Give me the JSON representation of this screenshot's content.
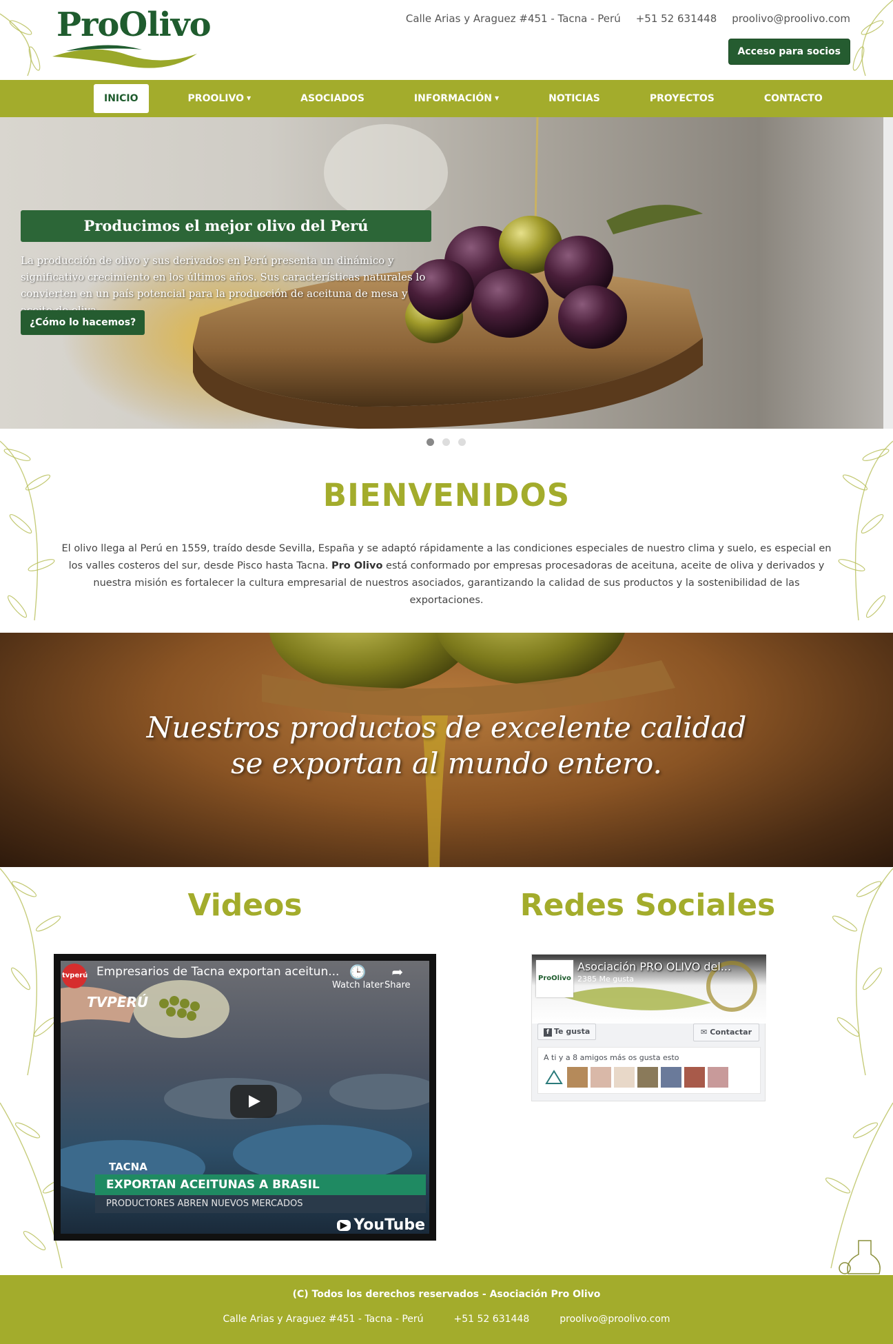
{
  "header": {
    "logo_text": "ProOlivo",
    "address": "Calle Arias y Araguez #451 - Tacna - Perú",
    "phone": "+51 52 631448",
    "email": "proolivo@proolivo.com",
    "members_button": "Acceso para socios"
  },
  "nav": {
    "items": [
      {
        "label": "INICIO",
        "active": true
      },
      {
        "label": "PROOLIVO",
        "dropdown": true
      },
      {
        "label": "ASOCIADOS"
      },
      {
        "label": "INFORMACIÓN",
        "dropdown": true
      },
      {
        "label": "NOTICIAS"
      },
      {
        "label": "PROYECTOS"
      },
      {
        "label": "CONTACTO"
      }
    ]
  },
  "slider": {
    "title": "Producimos el mejor olivo del Perú",
    "text": "La producción de olivo y sus derivados en Perú presenta un dinámico y significativo crecimiento en los últimos años. Sus características naturales lo convierten en un país potencial para la producción de aceituna de mesa y aceite de oliva.",
    "button": "¿Cómo lo hacemos?",
    "slides_count": 3,
    "active_slide": 1
  },
  "welcome": {
    "title": "BIENVENIDOS",
    "text_before": "El olivo llega al Perú en 1559, traído desde Sevilla, España y se adaptó rápidamente a las condiciones especiales de nuestro clima y suelo, es especial en los valles costeros del sur, desde Pisco hasta Tacna. ",
    "text_bold": "Pro Olivo",
    "text_after": " está conformado por empresas procesadoras de aceituna, aceite de oliva y derivados y nuestra misión es fortalecer la cultura empresarial de nuestros asociados, garantizando la calidad de sus productos y la sostenibilidad de las exportaciones."
  },
  "banner": {
    "line1": "Nuestros productos de excelente calidad",
    "line2": "se exportan al mundo entero."
  },
  "videos": {
    "title": "Videos",
    "video_title": "Empresarios de Tacna exportan aceitun...",
    "channel": "tvperú",
    "watch_later": "Watch later",
    "share": "Share",
    "tv_logo": "TVPERÚ",
    "tv_location": "TACNA",
    "tv_headline": "EXPORTAN ACEITUNAS A BRASIL",
    "tv_sub": "PRODUCTORES ABREN NUEVOS MERCADOS",
    "brand": "YouTube"
  },
  "social": {
    "title": "Redes Sociales",
    "page_name": "Asociación PRO OLIVO del...",
    "likes": "2385 Me gusta",
    "thumb_text": "ProOlivo",
    "like_button": "Te gusta",
    "contact_button": "Contactar",
    "friends_text": "A ti y a 8 amigos más os gusta esto"
  },
  "footer": {
    "copyright": "(C) Todos los derechos reservados - Asociación Pro Olivo",
    "address": "Calle Arias y Araguez #451 - Tacna - Perú",
    "phone": "+51 52 631448",
    "email": "proolivo@proolivo.com"
  },
  "colors": {
    "brand_green": "#a3ac2c",
    "dark_green": "#255c30"
  }
}
